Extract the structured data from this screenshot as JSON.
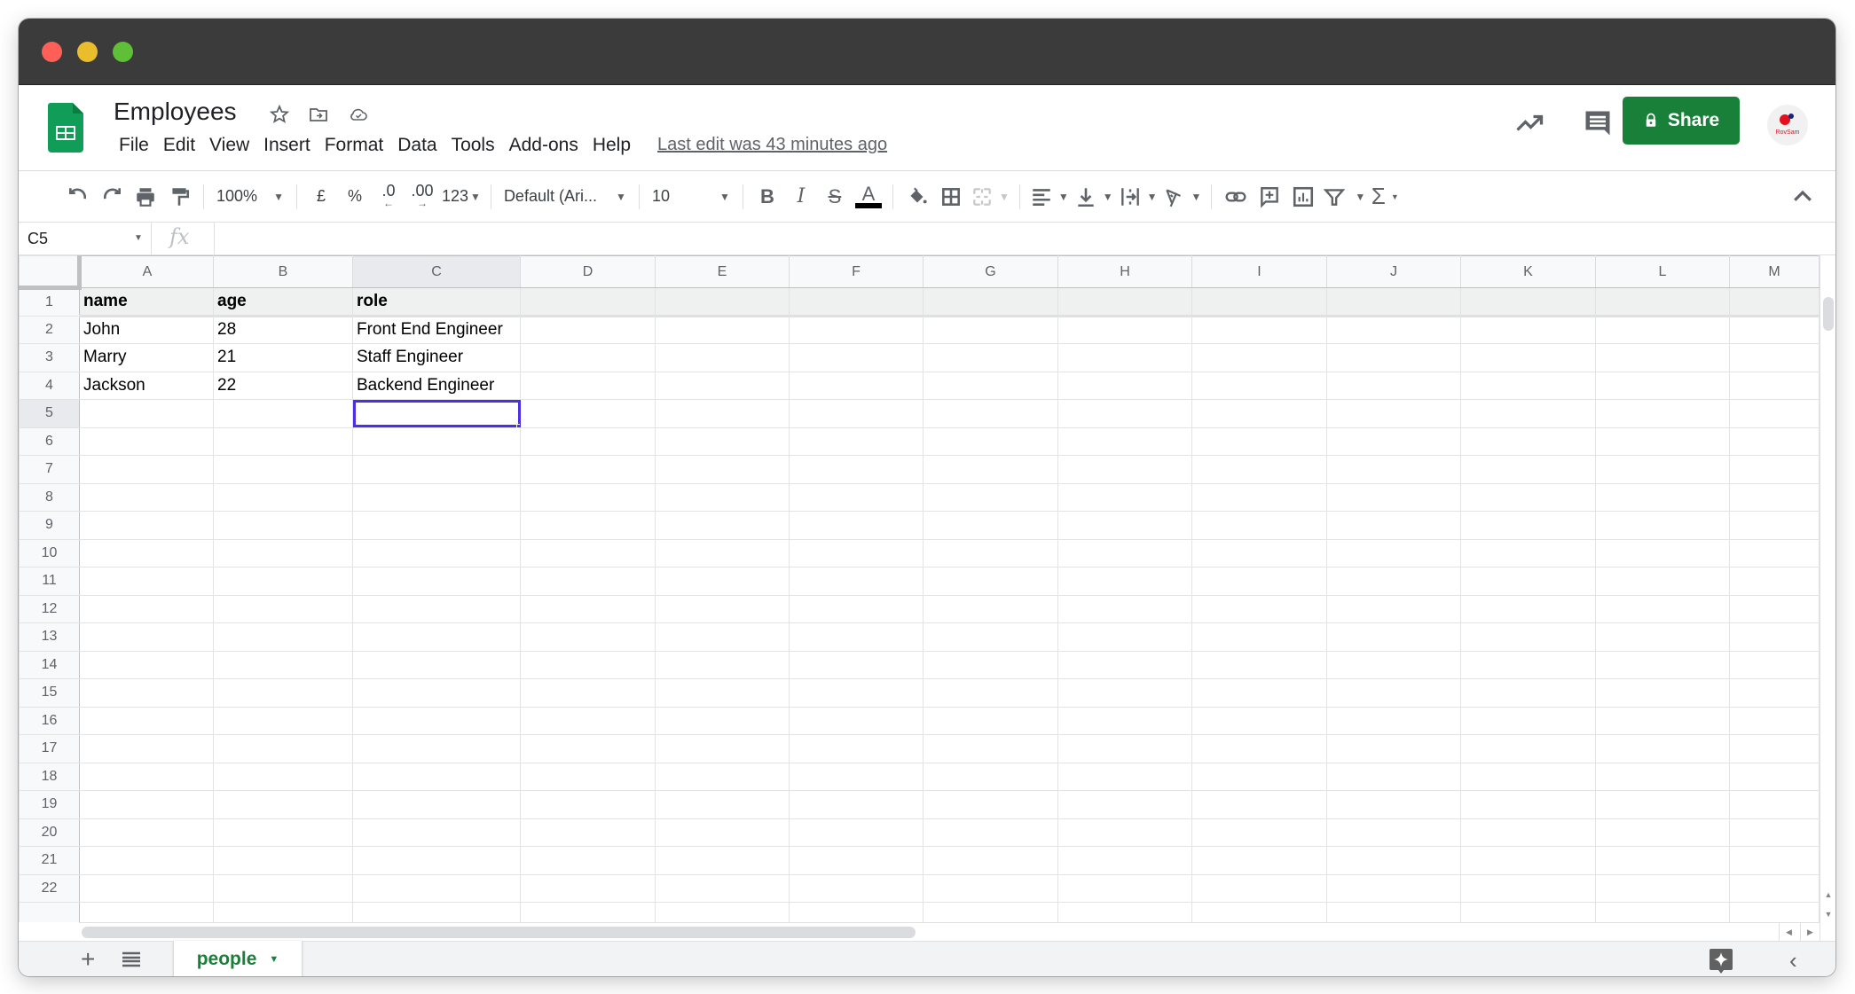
{
  "window": {
    "controls": [
      "close",
      "minimize",
      "maximize"
    ]
  },
  "header": {
    "title": "Employees",
    "title_icons": [
      "star-icon",
      "move-folder-icon",
      "cloud-saved-icon"
    ],
    "menu": [
      "File",
      "Edit",
      "View",
      "Insert",
      "Format",
      "Data",
      "Tools",
      "Add-ons",
      "Help"
    ],
    "last_edit": "Last edit was 43 minutes ago",
    "share_label": "Share",
    "avatar_text": "RovSam",
    "brand_color": "#188038"
  },
  "toolbar": {
    "zoom": "100%",
    "currency": "£",
    "percent": "%",
    "decrease_decimals": ".0",
    "increase_decimals": ".00",
    "more_formats": "123",
    "font": "Default (Ari...",
    "font_size": "10",
    "bold": "B",
    "italic": "I",
    "strikethrough": "S",
    "text_color_label": "A",
    "function_label": "Σ"
  },
  "formula_bar": {
    "cell_ref": "C5",
    "fx_label": "fx",
    "value": ""
  },
  "sheet": {
    "columns": [
      "A",
      "B",
      "C",
      "D",
      "E",
      "F",
      "G",
      "H",
      "I",
      "J",
      "K",
      "L",
      "M"
    ],
    "selected_column": "C",
    "selected_row": 5,
    "selected_cell": "C5",
    "row_count_visible": 22,
    "rows": [
      [
        "name",
        "age",
        "role"
      ],
      [
        "John",
        "28",
        "Front End Engineer"
      ],
      [
        "Marry",
        "21",
        "Staff Engineer"
      ],
      [
        "Jackson",
        "22",
        "Backend Engineer"
      ]
    ],
    "selection_color": "#4b2fe3"
  },
  "tabs": {
    "sheets": [
      {
        "name": "people",
        "active": true
      }
    ]
  }
}
